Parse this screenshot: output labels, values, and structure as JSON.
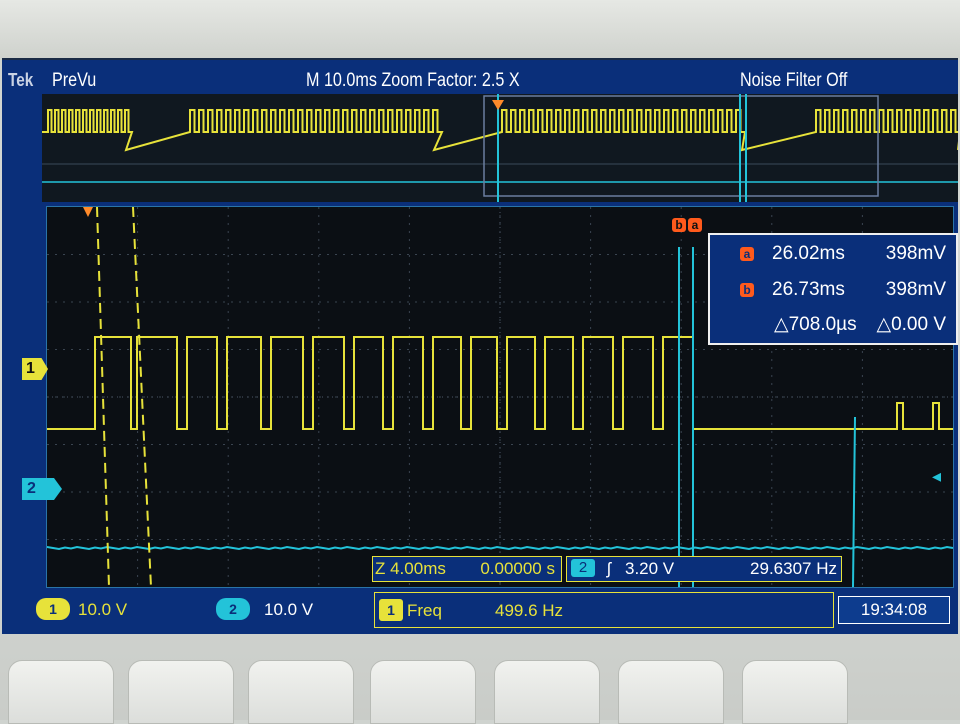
{
  "header": {
    "brand": "Tek",
    "mode": "PreVu",
    "title": "M 10.0ms  Zoom Factor: 2.5 X",
    "noise_filter": "Noise Filter Off"
  },
  "channels": {
    "ch1": {
      "marker": "1",
      "scale": "10.0 V",
      "color": "#e7e23a"
    },
    "ch2": {
      "marker": "2",
      "scale": "10.0 V",
      "color": "#23c3d9"
    }
  },
  "cursors": {
    "label_a": "a",
    "label_b": "b",
    "a": {
      "tag": "a",
      "time": "26.02ms",
      "value": "398mV"
    },
    "b": {
      "tag": "b",
      "time": "26.73ms",
      "value": "398mV"
    },
    "delta": {
      "time": "△708.0µs",
      "value": "△0.00 V"
    }
  },
  "zoom": {
    "time_per_div": "Z 4.00ms",
    "position": "0.00000 s"
  },
  "trigger": {
    "channel": "2",
    "slope_icon": "rising-edge-icon",
    "slope": "ʃ",
    "level": "3.20 V",
    "frequency": "29.6307 Hz"
  },
  "measurement": {
    "channel": "1",
    "name": "Freq",
    "value": "499.6 Hz"
  },
  "clock": "19:34:08",
  "colors": {
    "screen": "#0a2f7a",
    "grid": "#0b0f14",
    "cursor": "#ff5a1c"
  }
}
